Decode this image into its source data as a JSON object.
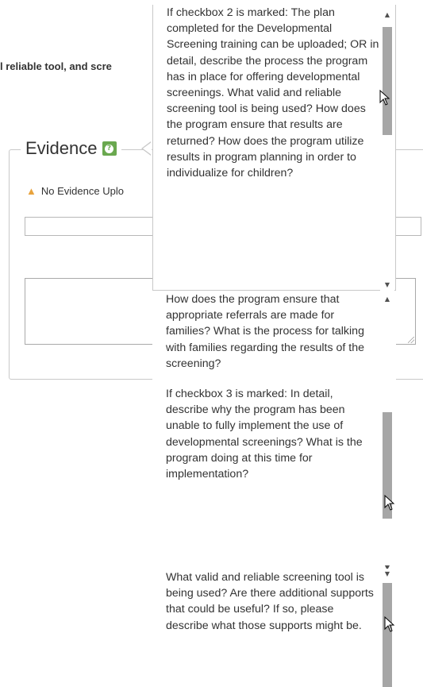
{
  "heading_fragment": "l reliable tool, and scre",
  "evidence": {
    "title": "Evidence",
    "help_icon": "help-icon",
    "no_evidence_text": "No Evidence Uplo",
    "warning_icon": "warning-triangle-icon",
    "warning_color": "#e8a33d",
    "help_color": "#6aa84f"
  },
  "tooltip": {
    "panel1_para1": "If checkbox 2 is marked: The plan completed for the Developmental Screening training can be uploaded; OR in detail, describe the process the program has in place for offering developmental screenings. What valid and reliable screening tool is being used? How does the program ensure that results are returned? How does the program utilize results in program planning in order to individualize for children?",
    "panel2_para1": "How does the program ensure that appropriate referrals are made for families? What is the process for talking with families regarding the results of the screening?",
    "panel2_para2": "If checkbox 3 is marked: In detail, describe why the program has been unable to fully implement the use of developmental screenings? What is the program doing at this time for implementation?",
    "panel3_para1": "What valid and reliable screening tool is being used? Are there additional supports that could be useful? If so, please describe what those supports might be."
  },
  "scrollbar": {
    "up_glyph": "▲",
    "down_glyph": "▼"
  }
}
